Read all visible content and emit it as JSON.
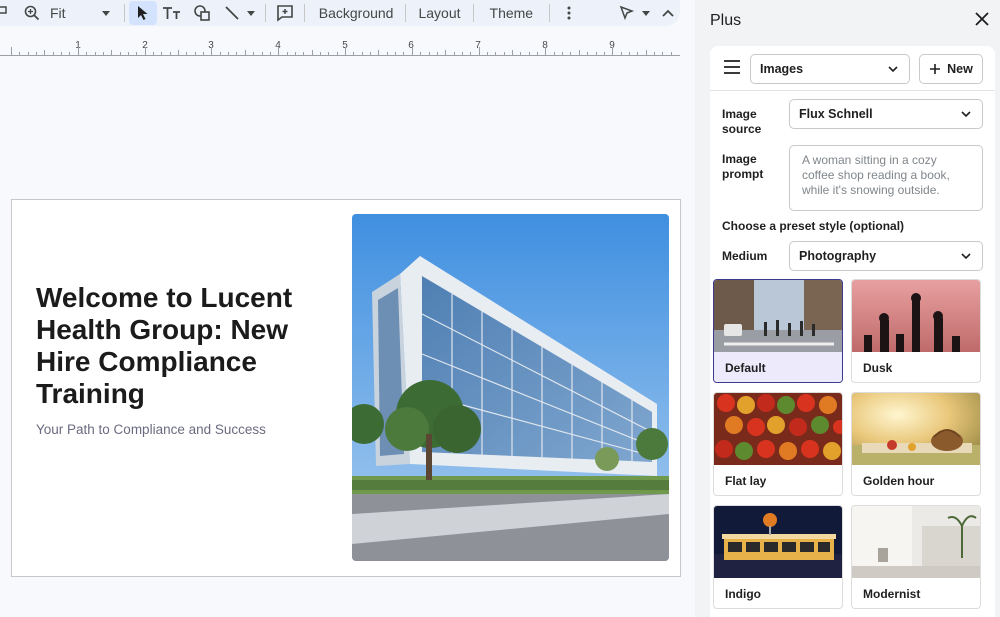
{
  "toolbar": {
    "zoom_value": "Fit",
    "background_label": "Background",
    "layout_label": "Layout",
    "theme_label": "Theme"
  },
  "ruler": {
    "labels": [
      "1",
      "2",
      "3",
      "4",
      "5",
      "6",
      "7",
      "8",
      "9"
    ]
  },
  "slide": {
    "title": "Welcome to Lucent Health Group: New Hire Compliance Training",
    "subtitle": "Your Path to Compliance and Success"
  },
  "panel": {
    "title": "Plus",
    "mode_select": "Images",
    "new_label": "New",
    "image_source_label": "Image source",
    "image_source_value": "Flux Schnell",
    "image_prompt_label": "Image prompt",
    "image_prompt_placeholder": "A woman sitting in a cozy coffee shop reading a book, while it's snowing outside.",
    "preset_label": "Choose a preset style (optional)",
    "medium_label": "Medium",
    "medium_value": "Photography",
    "styles": [
      {
        "label": "Default",
        "selected": true
      },
      {
        "label": "Dusk",
        "selected": false
      },
      {
        "label": "Flat lay",
        "selected": false
      },
      {
        "label": "Golden hour",
        "selected": false
      },
      {
        "label": "Indigo",
        "selected": false
      },
      {
        "label": "Modernist",
        "selected": false
      }
    ]
  },
  "colors": {
    "toolbar_bg": "#edf2fa",
    "selected_tile_border": "#3b3a8c",
    "selected_tile_bg": "#eceafb"
  }
}
